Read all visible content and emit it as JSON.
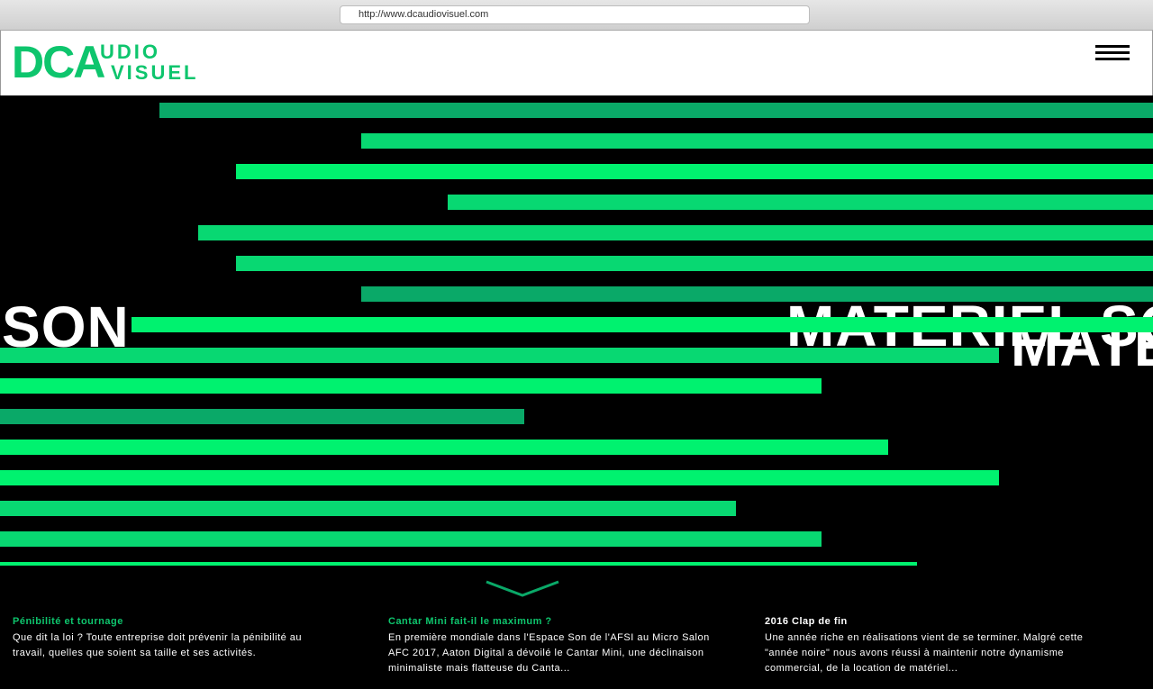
{
  "browser": {
    "url": "http://www.dcaudiovisuel.com"
  },
  "logo": {
    "part1": "DCA",
    "part2": "UDIO",
    "part3": "VISUEL"
  },
  "menu": {
    "icon": "hamburger-menu-icon"
  },
  "hero": {
    "word_left": "SON",
    "word_right": "MATERIEL SON",
    "word_right_lower": "MATERIEL"
  },
  "colors": {
    "accent": "#0ec56d",
    "bright": "#00f26f",
    "mid": "#08d872",
    "dark": "#0aa968",
    "background": "#000000"
  },
  "news": [
    {
      "title": "Pénibilité et tournage",
      "text": "Que dit la loi ? Toute entreprise doit prévenir la pénibilité au travail, quelles que soient sa taille et ses activités.",
      "title_color": "#0ec56d"
    },
    {
      "title": "Cantar Mini fait-il le maximum ?",
      "text": "En première mondiale dans l'Espace Son de l'AFSI au Micro Salon AFC 2017, Aaton Digital a dévoilé le Cantar Mini, une déclinaison minimaliste mais flatteuse du Canta...",
      "title_color": "#0ec56d"
    },
    {
      "title": "2016 Clap de fin",
      "text": "Une année riche en réalisations vient de se terminer. Malgré cette \"année noire\" nous avons réussi à maintenir notre dynamisme commercial, de la location de matériel...",
      "title_color": "#ffffff"
    }
  ],
  "scroll": {
    "icon": "chevron-down-icon"
  }
}
